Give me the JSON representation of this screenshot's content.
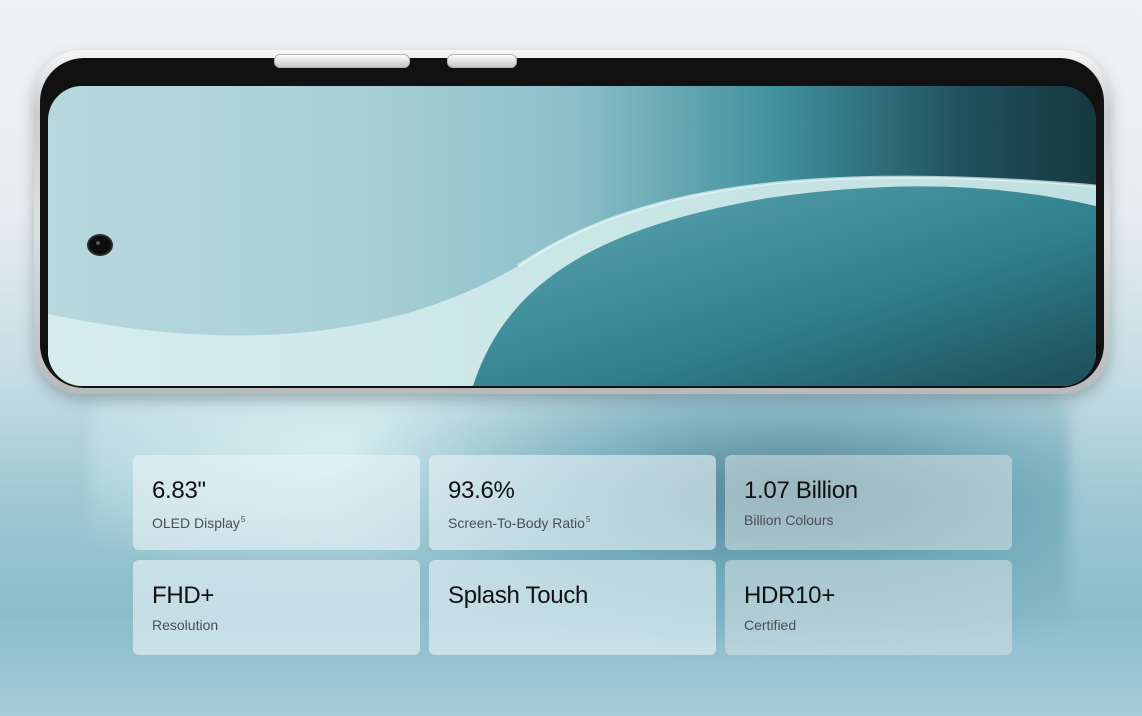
{
  "specs": [
    {
      "value": "6.83\"",
      "label": "OLED Display",
      "sup": "5"
    },
    {
      "value": "93.6%",
      "label": "Screen-To-Body Ratio",
      "sup": "5"
    },
    {
      "value": "1.07 Billion",
      "label": "Billion Colours"
    },
    {
      "value": "FHD+",
      "label": "Resolution"
    },
    {
      "value": "Splash Touch",
      "label": ""
    },
    {
      "value": "HDR10+",
      "label": "Certified"
    }
  ],
  "colors": {
    "card_bg": "#e8f2f5",
    "screen_teal": "#3f8f9c",
    "dark_teal": "#173840"
  }
}
